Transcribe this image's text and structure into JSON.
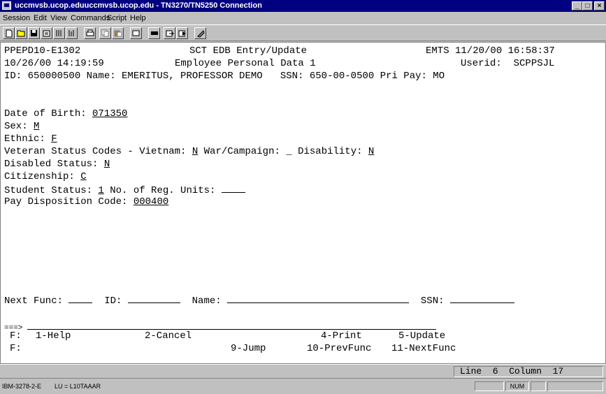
{
  "window": {
    "title": "uccmvsb.ucop.eduuccmvsb.ucop.edu - TN3270/TN5250 Connection",
    "controls": [
      "_",
      "□",
      "×"
    ]
  },
  "menu": [
    "Session",
    "Edit",
    "View",
    "Commands",
    "Script",
    "Help"
  ],
  "toolbar": [
    "new-icon",
    "open-icon",
    "save-icon",
    "properties-icon",
    "send-icon",
    "receive-icon",
    "print-icon",
    "copy-icon",
    "paste-icon",
    "clear-icon",
    "keyboard-icon",
    "macro-icon",
    "play-icon",
    "stop-icon"
  ],
  "screen": {
    "hdr1_left": "PPEPD10-E1302",
    "hdr1_mid": "SCT EDB Entry/Update",
    "hdr1_right": "EMTS 11/20/00 16:58:37",
    "hdr2_left": "10/26/00 14:19:59",
    "hdr2_mid": "Employee Personal Data 1",
    "hdr2_right": "Userid:  SCPPSJL",
    "id_line": "ID: 650000500 Name: EMERITUS, PROFESSOR DEMO   SSN: 650-00-0500 Pri Pay: MO",
    "fields": {
      "dob_label": "Date of Birth: ",
      "dob": "071350",
      "sex_label": "Sex: ",
      "sex": "M",
      "ethnic_label": "Ethnic: ",
      "ethnic": "F",
      "vet_label": "Veteran Status Codes - Vietnam: ",
      "vietnam": "N",
      "war_label": " War/Campaign: ",
      "war": "_",
      "disab_label": " Disability: ",
      "disability": "N",
      "disabled_label": "Disabled Status: ",
      "disabled": "N",
      "citizen_label": "Citizenship: ",
      "citizenship": "C",
      "student_label": "Student Status: ",
      "student": "1",
      "units_label": " No. of Reg. Units: ",
      "paydisp_label": "Pay Disposition Code: ",
      "paydisp": "000400"
    },
    "next": {
      "func_label": "Next Func: ",
      "id_label": "ID: ",
      "name_label": "Name: ",
      "ssn_label": "SSN: "
    },
    "command_prompt": "===>",
    "fkeys1": {
      "label": "F:",
      "k1": "1-Help",
      "k2": "2-Cancel",
      "k4": "4-Print",
      "k5": "5-Update"
    },
    "fkeys2": {
      "label": "F:",
      "k9": "9-Jump",
      "k10": "10-PrevFunc",
      "k11": "11-NextFunc"
    }
  },
  "cursor": "Line  6  Column  17",
  "status": {
    "terminal": "IBM-3278-2-E",
    "lu": "LU = L10TAAAR",
    "num": "NUM"
  }
}
